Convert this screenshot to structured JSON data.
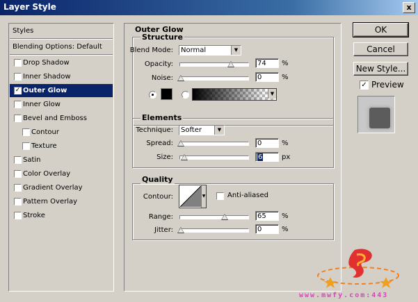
{
  "window": {
    "title": "Layer Style",
    "close_label": "x"
  },
  "left_panel": {
    "header": "Styles",
    "blending": "Blending Options: Default",
    "items": [
      {
        "label": "Drop Shadow",
        "checked": false,
        "indent": false
      },
      {
        "label": "Inner Shadow",
        "checked": false,
        "indent": false
      },
      {
        "label": "Outer Glow",
        "checked": true,
        "indent": false,
        "selected": true
      },
      {
        "label": "Inner Glow",
        "checked": false,
        "indent": false
      },
      {
        "label": "Bevel and Emboss",
        "checked": false,
        "indent": false
      },
      {
        "label": "Contour",
        "checked": false,
        "indent": true
      },
      {
        "label": "Texture",
        "checked": false,
        "indent": true
      },
      {
        "label": "Satin",
        "checked": false,
        "indent": false
      },
      {
        "label": "Color Overlay",
        "checked": false,
        "indent": false
      },
      {
        "label": "Gradient Overlay",
        "checked": false,
        "indent": false
      },
      {
        "label": "Pattern Overlay",
        "checked": false,
        "indent": false
      },
      {
        "label": "Stroke",
        "checked": false,
        "indent": false
      }
    ]
  },
  "main": {
    "section_title": "Outer Glow",
    "structure": {
      "title": "Structure",
      "blend_mode_label": "Blend Mode:",
      "blend_mode_value": "Normal",
      "opacity_label": "Opacity:",
      "opacity_value": "74",
      "noise_label": "Noise:",
      "noise_value": "0",
      "unit": "%"
    },
    "elements": {
      "title": "Elements",
      "technique_label": "Technique:",
      "technique_value": "Softer",
      "spread_label": "Spread:",
      "spread_value": "0",
      "size_label": "Size:",
      "size_value": "6",
      "pct": "%",
      "px": "px"
    },
    "quality": {
      "title": "Quality",
      "contour_label": "Contour:",
      "antialias_label": "Anti-aliased",
      "range_label": "Range:",
      "range_value": "65",
      "jitter_label": "Jitter:",
      "jitter_value": "0",
      "unit": "%"
    }
  },
  "buttons": {
    "ok": "OK",
    "cancel": "Cancel",
    "new_style": "New Style...",
    "preview_label": "Preview"
  },
  "watermark": "www.mwfy.com:443"
}
